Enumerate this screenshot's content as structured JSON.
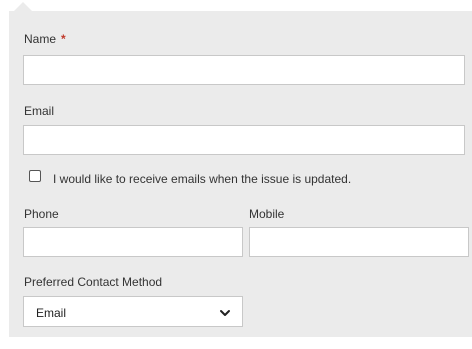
{
  "form": {
    "name": {
      "label": "Name",
      "required_mark": "*",
      "value": ""
    },
    "email": {
      "label": "Email",
      "value": ""
    },
    "notify_checkbox": {
      "label": "I would like to receive emails when the issue is updated.",
      "checked": false
    },
    "phone": {
      "label": "Phone",
      "value": ""
    },
    "mobile": {
      "label": "Mobile",
      "value": ""
    },
    "preferred_contact": {
      "label": "Preferred Contact Method",
      "selected": "Email"
    }
  },
  "icons": {
    "dropdown": "chevron-down-icon"
  },
  "colors": {
    "panel_bg": "#ebebeb",
    "required": "#c0392b",
    "field_border": "#c8c8c8"
  }
}
